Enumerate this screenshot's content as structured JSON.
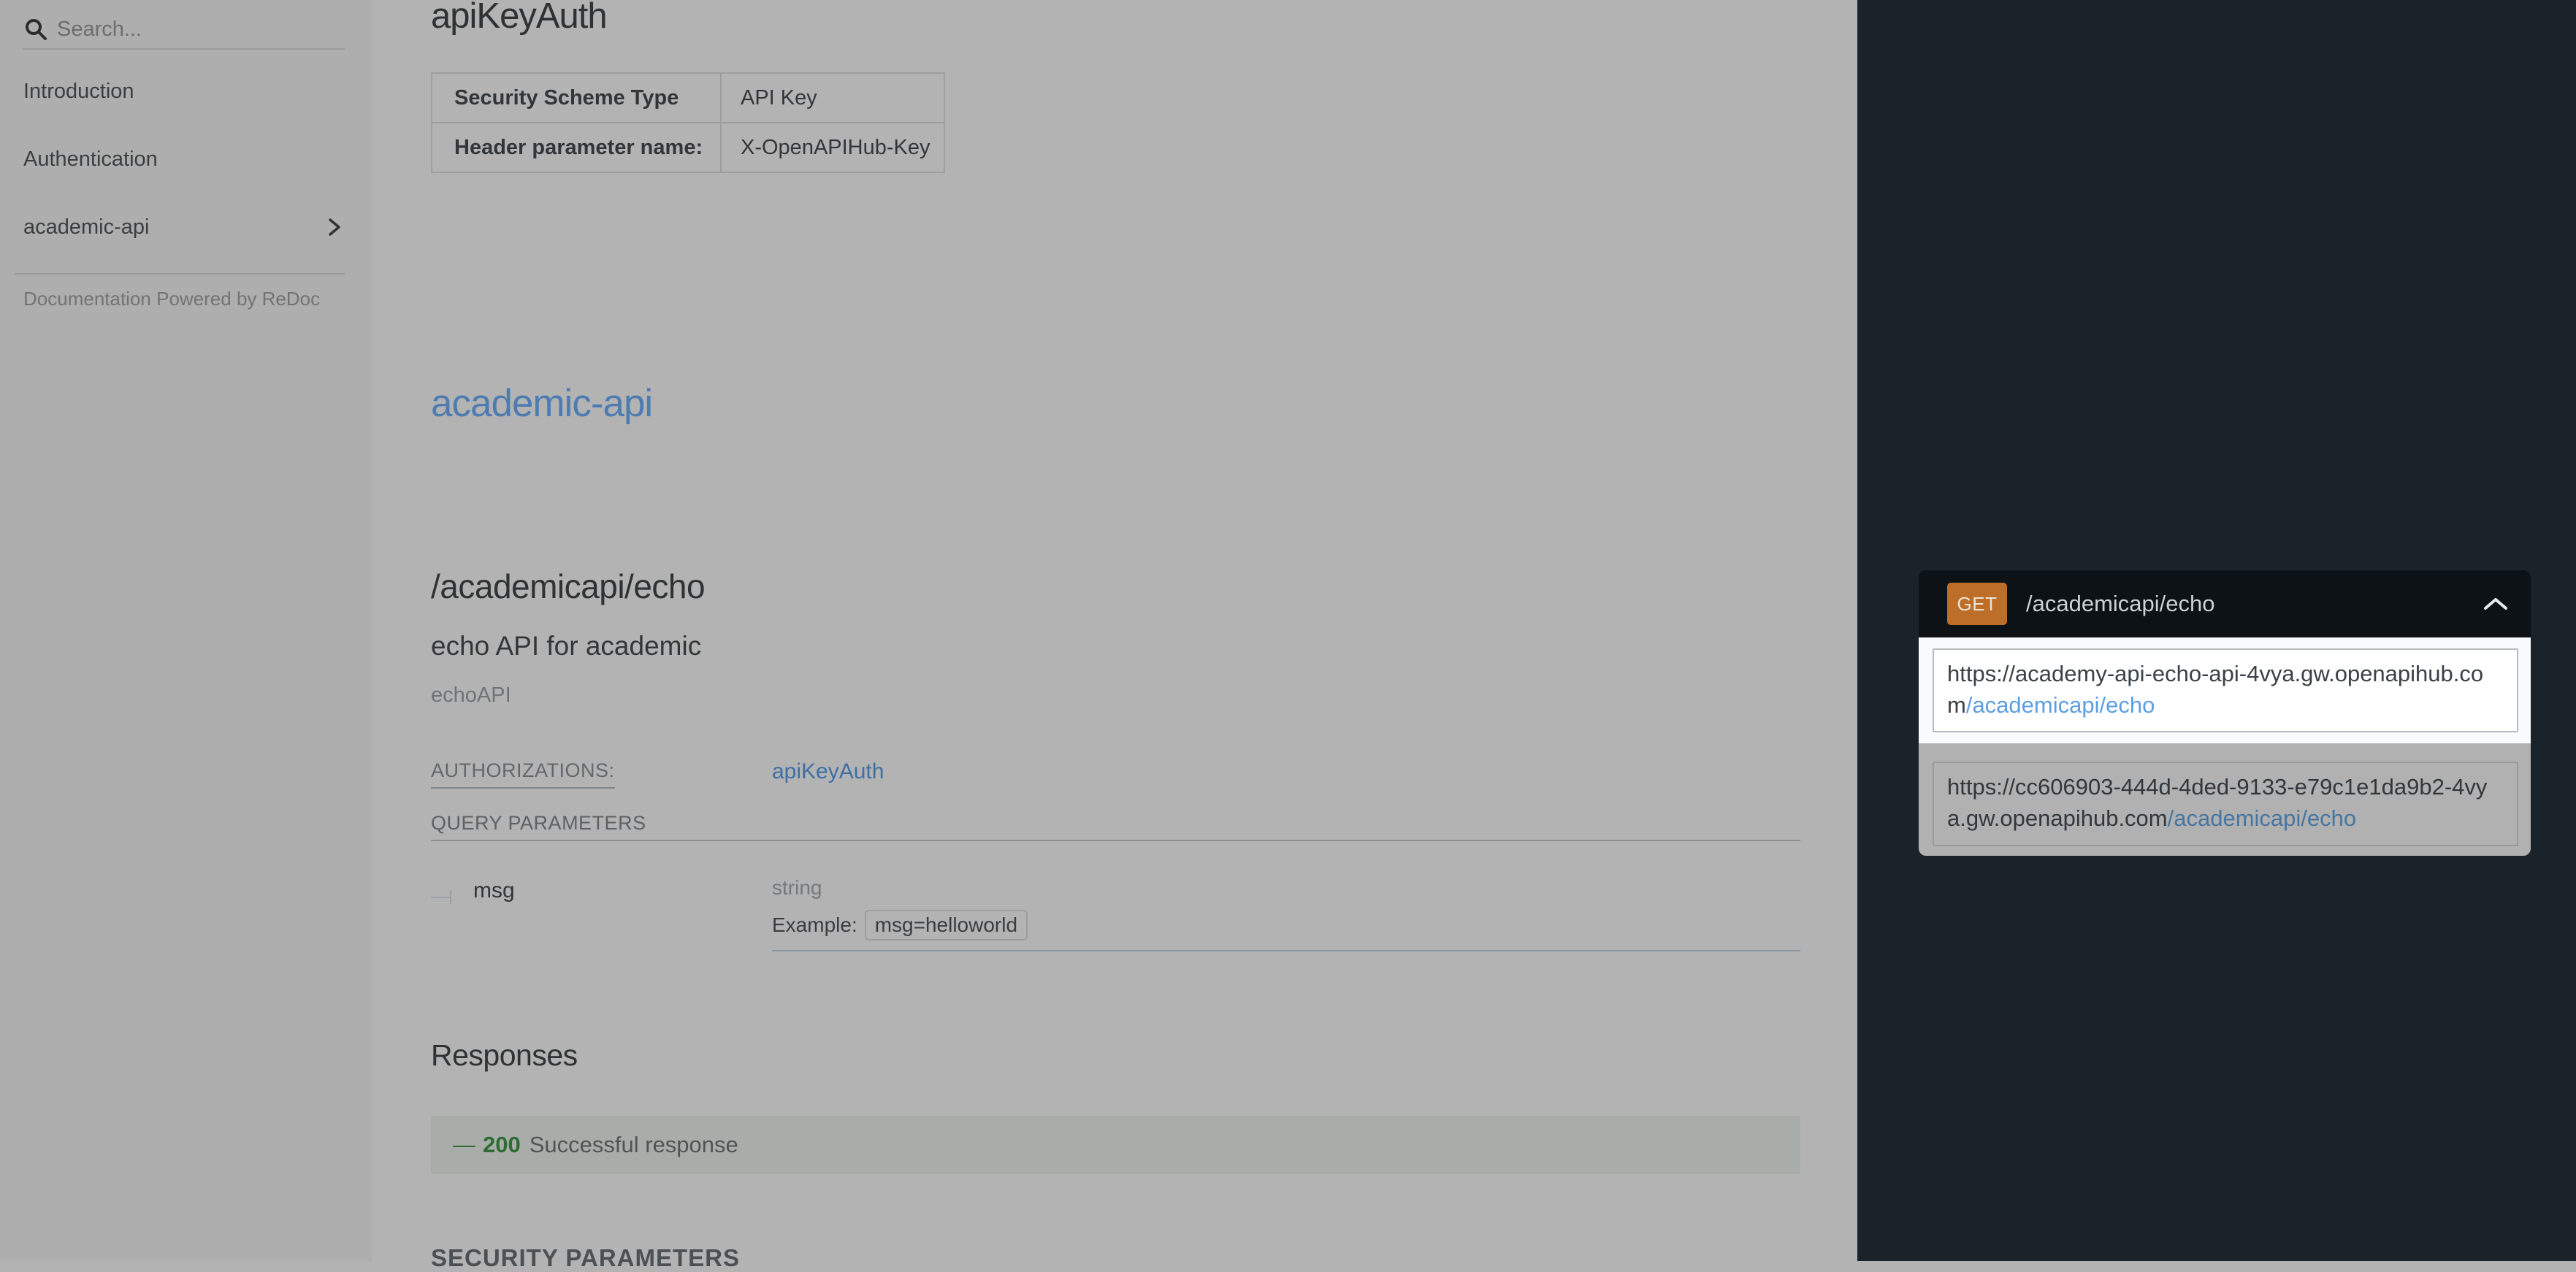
{
  "sidebar": {
    "search_placeholder": "Search...",
    "items": [
      {
        "label": "Introduction"
      },
      {
        "label": "Authentication"
      },
      {
        "label": "academic-api",
        "has_submenu": true
      }
    ],
    "footer": "Documentation Powered by ReDoc"
  },
  "content": {
    "security_section": {
      "title": "apiKeyAuth",
      "table": {
        "rows": [
          {
            "label": "Security Scheme Type",
            "value": "API Key"
          },
          {
            "label": "Header parameter name:",
            "value": "X-OpenAPIHub-Key"
          }
        ]
      }
    },
    "tag_title": "academic-api",
    "operation": {
      "path_title": "/academicapi/echo",
      "summary": "echo API for academic",
      "operation_id": "echoAPI",
      "authorizations_label": "AUTHORIZATIONS:",
      "authorizations_value": "apiKeyAuth",
      "query_parameters_label": "QUERY PARAMETERS",
      "parameter": {
        "name": "msg",
        "type": "string",
        "example_label": "Example:",
        "example_value": "msg=helloworld"
      },
      "responses_label": "Responses",
      "responses": [
        {
          "dash": "—",
          "code": "200",
          "description": "Successful response"
        }
      ],
      "security_parameters_label": "SECURITY PARAMETERS"
    }
  },
  "request_panel": {
    "method": "GET",
    "path": "/academicapi/echo",
    "servers": [
      {
        "base": "https://academy-api-echo-api-4vya.gw.openapihub.com",
        "path": "/academicapi/echo",
        "highlighted": true
      },
      {
        "base": "https://cc606903-444d-4ded-9133-e79c1e1da9b2-4vya.gw.openapihub.com",
        "path": "/academicapi/echo",
        "highlighted": false
      }
    ]
  },
  "colors": {
    "method_get_badge": "#bd6e29",
    "link_blue": "#3d6fa6",
    "url_link_blue_bright": "#5d9ee3",
    "success_green": "#2e6c33",
    "panel_dark": "#1a222a",
    "header_dark": "#0d1217",
    "dim_overlay_gray": "#b3b3b3",
    "highlight_white": "#ffffff"
  }
}
